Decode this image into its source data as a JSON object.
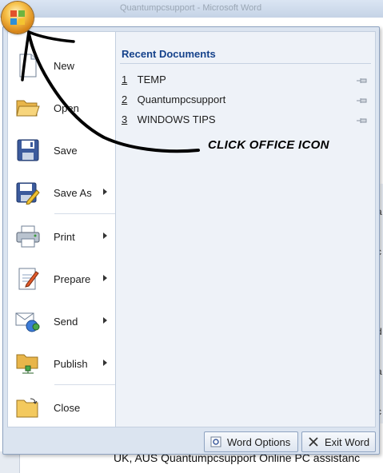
{
  "background": {
    "title_text": "Quantumpcsupport - Microsoft Word",
    "bottom_text": "UK, AUS Quantumpcsupport Online PC assistanc",
    "edge_letters": [
      "a",
      "c",
      "f",
      "d",
      "a",
      "c"
    ]
  },
  "office_button": {
    "icon": "office-logo-icon"
  },
  "menu": {
    "items": [
      {
        "label": "New",
        "icon": "new-document-icon",
        "submenu": false
      },
      {
        "label": "Open",
        "icon": "open-folder-icon",
        "submenu": false
      },
      {
        "label": "Save",
        "icon": "floppy-disk-icon",
        "submenu": false
      },
      {
        "label": "Save As",
        "icon": "save-as-icon",
        "submenu": true
      },
      {
        "label": "Print",
        "icon": "printer-icon",
        "submenu": true
      },
      {
        "label": "Prepare",
        "icon": "prepare-icon",
        "submenu": true
      },
      {
        "label": "Send",
        "icon": "send-icon",
        "submenu": true
      },
      {
        "label": "Publish",
        "icon": "publish-icon",
        "submenu": true
      },
      {
        "label": "Close",
        "icon": "close-folder-icon",
        "submenu": false
      }
    ],
    "recent": {
      "title": "Recent Documents",
      "documents": [
        {
          "number": "1",
          "name": "TEMP"
        },
        {
          "number": "2",
          "name": "Quantumpcsupport"
        },
        {
          "number": "3",
          "name": "WINDOWS TIPS"
        }
      ]
    },
    "footer": {
      "options_label": "Word Options",
      "exit_label": "Exit Word"
    }
  },
  "annotation": {
    "text": "CLICK OFFICE ICON"
  },
  "colors": {
    "accent": "#15428b",
    "menu_bg": "#dbe4f0",
    "orb": "#f7c24a"
  }
}
